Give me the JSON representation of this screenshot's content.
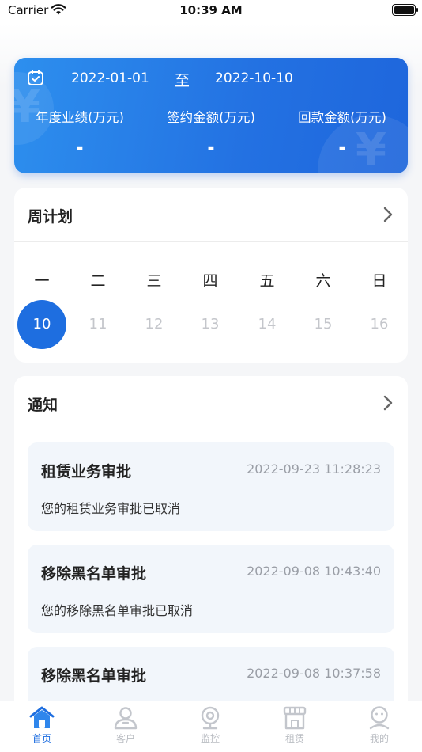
{
  "status_bar": {
    "carrier": "Carrier",
    "time": "10:39 AM"
  },
  "summary": {
    "date_start": "2022-01-01",
    "separator": "至",
    "date_end": "2022-10-10",
    "metrics": [
      {
        "label": "年度业绩(万元)",
        "value": "-"
      },
      {
        "label": "签约金额(万元)",
        "value": "-"
      },
      {
        "label": "回款金额(万元)",
        "value": "-"
      }
    ]
  },
  "week_plan": {
    "title": "周计划",
    "weekdays": [
      "一",
      "二",
      "三",
      "四",
      "五",
      "六",
      "日"
    ],
    "dates": [
      "10",
      "11",
      "12",
      "13",
      "14",
      "15",
      "16"
    ],
    "selected_index": 0
  },
  "notices": {
    "title": "通知",
    "items": [
      {
        "title": "租赁业务审批",
        "time": "2022-09-23 11:28:23",
        "text": "您的租赁业务审批已取消"
      },
      {
        "title": "移除黑名单审批",
        "time": "2022-09-08 10:43:40",
        "text": "您的移除黑名单审批已取消"
      },
      {
        "title": "移除黑名单审批",
        "time": "2022-09-08 10:37:58",
        "text": ""
      }
    ]
  },
  "tabbar": {
    "items": [
      {
        "label": "首页",
        "icon": "home-icon",
        "active": true
      },
      {
        "label": "客户",
        "icon": "user-icon",
        "active": false
      },
      {
        "label": "监控",
        "icon": "camera-icon",
        "active": false
      },
      {
        "label": "租赁",
        "icon": "store-icon",
        "active": false
      },
      {
        "label": "我的",
        "icon": "profile-icon",
        "active": false
      }
    ]
  },
  "colors": {
    "primary": "#1e6ee0",
    "card_gradient_start": "#2d8fee",
    "notice_bg": "#f2f6fb"
  }
}
